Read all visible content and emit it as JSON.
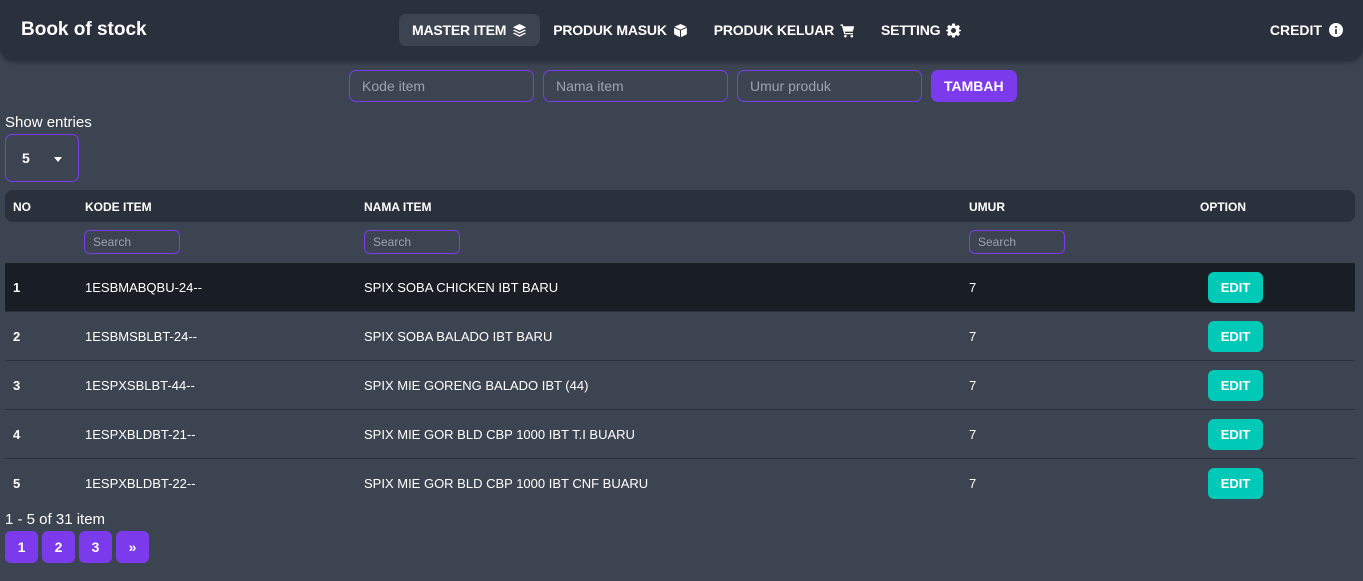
{
  "app": {
    "brand": "Book of stock"
  },
  "nav": {
    "items": [
      {
        "label": "MASTER ITEM",
        "icon": "layers-icon",
        "active": true
      },
      {
        "label": "PRODUK MASUK",
        "icon": "box-icon",
        "active": false
      },
      {
        "label": "PRODUK KELUAR",
        "icon": "cart-icon",
        "active": false
      },
      {
        "label": "SETTING",
        "icon": "gear-icon",
        "active": false
      }
    ],
    "credit": {
      "label": "CREDIT",
      "icon": "info-icon"
    }
  },
  "add_form": {
    "kode_placeholder": "Kode item",
    "nama_placeholder": "Nama item",
    "umur_placeholder": "Umur produk",
    "submit_label": "TAMBAH"
  },
  "entries": {
    "label": "Show entries",
    "value": "5"
  },
  "table": {
    "headers": {
      "no": "NO",
      "kode": "KODE ITEM",
      "nama": "NAMA ITEM",
      "umur": "UMUR",
      "option": "OPTION"
    },
    "filter_placeholder": "Search",
    "rows": [
      {
        "no": "1",
        "kode": "1ESBMABQBU-24--",
        "nama": "SPIX SOBA CHICKEN IBT BARU",
        "umur": "7",
        "action": "EDIT"
      },
      {
        "no": "2",
        "kode": "1ESBMSBLBT-24--",
        "nama": "SPIX SOBA BALADO IBT BARU",
        "umur": "7",
        "action": "EDIT"
      },
      {
        "no": "3",
        "kode": "1ESPXSBLBT-44--",
        "nama": "SPIX MIE GORENG BALADO IBT (44)",
        "umur": "7",
        "action": "EDIT"
      },
      {
        "no": "4",
        "kode": "1ESPXBLDBT-21--",
        "nama": "SPIX MIE GOR BLD CBP 1000 IBT T.I BUARU",
        "umur": "7",
        "action": "EDIT"
      },
      {
        "no": "5",
        "kode": "1ESPXBLDBT-22--",
        "nama": "SPIX MIE GOR BLD CBP 1000 IBT CNF BUARU",
        "umur": "7",
        "action": "EDIT"
      }
    ]
  },
  "pagination": {
    "info": "1 - 5 of 31 item",
    "pages": [
      "1",
      "2",
      "3"
    ],
    "next_label": "»"
  },
  "colors": {
    "background": "#3d4451",
    "navbar": "#2a303c",
    "accent": "#7c3aed",
    "edit_button": "#00c9b7",
    "highlight_row": "#191d24"
  }
}
